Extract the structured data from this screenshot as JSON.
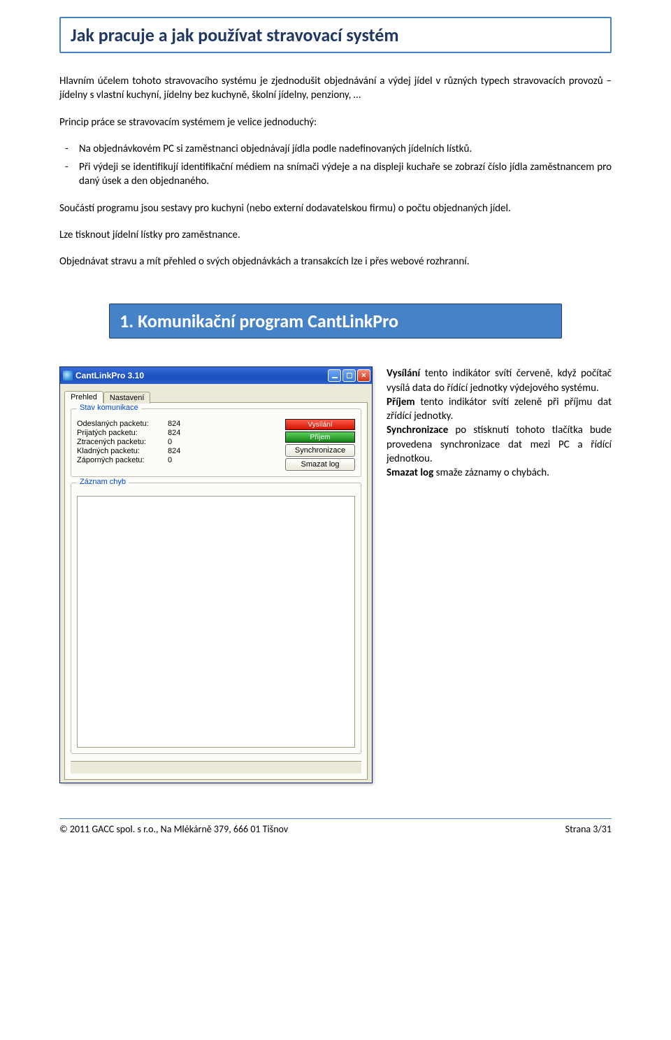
{
  "heading1": "Jak pracuje a jak používat stravovací systém",
  "intro": "Hlavním účelem tohoto stravovacího systému je zjednodušit objednávání a výdej jídel v různých typech stravovacích provozů – jídelny s vlastní kuchyní, jídelny bez kuchyně, školní jídelny, penziony, …",
  "princip": "Princip práce se stravovacím systémem je velice jednoduchý:",
  "bullets": [
    "Na objednávkovém PC si zaměstnanci objednávají jídla podle nadefinovaných jídelních lístků.",
    "Při výdeji se identifikují identifikační médiem na snímači výdeje a na displeji kuchaře se zobrazí číslo jídla zaměstnancem pro daný úsek a den objednaného."
  ],
  "p_soucast": "Součástí programu jsou sestavy pro kuchyni (nebo externí dodavatelskou firmu) o počtu objednaných jídel.",
  "p_tisk": "Lze tisknout jídelní lístky pro zaměstnance.",
  "p_web": "Objednávat stravu a mít přehled o svých objednávkách a transakcích lze i přes webové rozhranní.",
  "heading2": "1. Komunikační program CantLinkPro",
  "app": {
    "title": "CantLinkPro 3.10",
    "tabs": {
      "prehled": "Prehled",
      "nastaveni": "Nastavení"
    },
    "group_comm": "Stav komunikace",
    "stats": [
      {
        "label": "Odeslaných packetu:",
        "value": "824"
      },
      {
        "label": "Prijatých packetu:",
        "value": "824"
      },
      {
        "label": "Ztracených packetu:",
        "value": "0"
      },
      {
        "label": "Kladných packetu:",
        "value": "824"
      },
      {
        "label": "Záporných packetu:",
        "value": "0"
      }
    ],
    "ind_send": "Vysílání",
    "ind_recv": "Příjem",
    "btn_sync": "Synchronizace",
    "btn_clear": "Smazat log",
    "group_err": "Záznam chyb"
  },
  "desc": {
    "vysilani_t": "Vysílání",
    "vysilani_d": "tento indikátor svítí červeně, když počítač vysílá data do řídící jednotky výdejového systému.",
    "prijem_t": "Příjem",
    "prijem_d": "tento indikátor svítí zeleně při příjmu dat zřídící jednotky.",
    "sync_t": "Synchronizace",
    "sync_d": "po stisknutí tohoto tlačítka bude provedena synchronizace dat mezi PC a řídící jednotkou.",
    "clear_t": "Smazat log",
    "clear_d": "smaže záznamy o chybách."
  },
  "footer": {
    "left": "© 2011 GACC spol. s r.o., Na Mlékárně 379, 666 01 Tišnov",
    "right": "Strana 3/31"
  }
}
